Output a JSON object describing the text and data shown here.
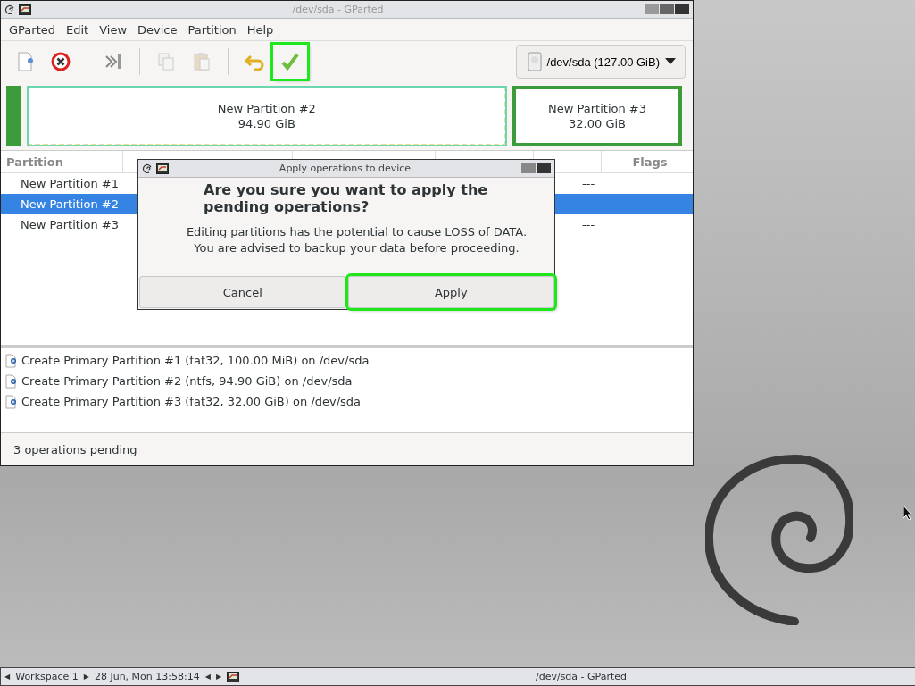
{
  "window": {
    "title": "/dev/sda - GParted"
  },
  "menu": [
    "GParted",
    "Edit",
    "View",
    "Device",
    "Partition",
    "Help"
  ],
  "toolbar": [
    {
      "kind": "new",
      "disabled": false,
      "highlighted": false
    },
    {
      "kind": "delete",
      "disabled": false,
      "highlighted": false
    },
    {
      "kind": "resize",
      "disabled": false,
      "highlighted": false
    },
    {
      "kind": "copy",
      "disabled": true,
      "highlighted": false
    },
    {
      "kind": "paste",
      "disabled": true,
      "highlighted": false
    },
    {
      "kind": "undo",
      "disabled": false,
      "highlighted": false
    },
    {
      "kind": "apply",
      "disabled": false,
      "highlighted": true
    }
  ],
  "device": {
    "label": "/dev/sda (127.00 GiB)"
  },
  "partition_map": [
    {
      "selected": false
    },
    {
      "name": "New Partition #2",
      "size": "94.90 GiB",
      "selected": true
    },
    {
      "name": "New Partition #3",
      "size": "32.00 GiB",
      "selected": false
    }
  ],
  "table": {
    "columns": [
      {
        "label": "Partition"
      },
      {
        "label": "Flags"
      }
    ],
    "rows": [
      {
        "partition": "New Partition #1",
        "unused": "---",
        "selected": false
      },
      {
        "partition": "New Partition #2",
        "unused": "---",
        "selected": true
      },
      {
        "partition": "New Partition #3",
        "unused": "---",
        "selected": false
      }
    ]
  },
  "operations": [
    "Create Primary Partition #1 (fat32, 100.00 MiB) on /dev/sda",
    "Create Primary Partition #2 (ntfs, 94.90 GiB) on /dev/sda",
    "Create Primary Partition #3 (fat32, 32.00 GiB) on /dev/sda"
  ],
  "status_bar": "3 operations pending",
  "dialog": {
    "title": "Apply operations to device",
    "heading": "Are you sure you want to apply the pending operations?",
    "message": "Editing partitions has the potential to cause LOSS of DATA.\nYou are advised to backup your data before proceeding.",
    "buttons": [
      {
        "label": "Cancel",
        "highlighted": false
      },
      {
        "label": "Apply",
        "highlighted": true
      }
    ]
  },
  "taskbar": {
    "workspace_prev": "◀",
    "workspace": "Workspace 1",
    "workspace_next": "▶",
    "task_prev": "◀",
    "task_next": "▶",
    "clock": "28 Jun, Mon 13:58:14",
    "task": "/dev/sda - GParted"
  }
}
